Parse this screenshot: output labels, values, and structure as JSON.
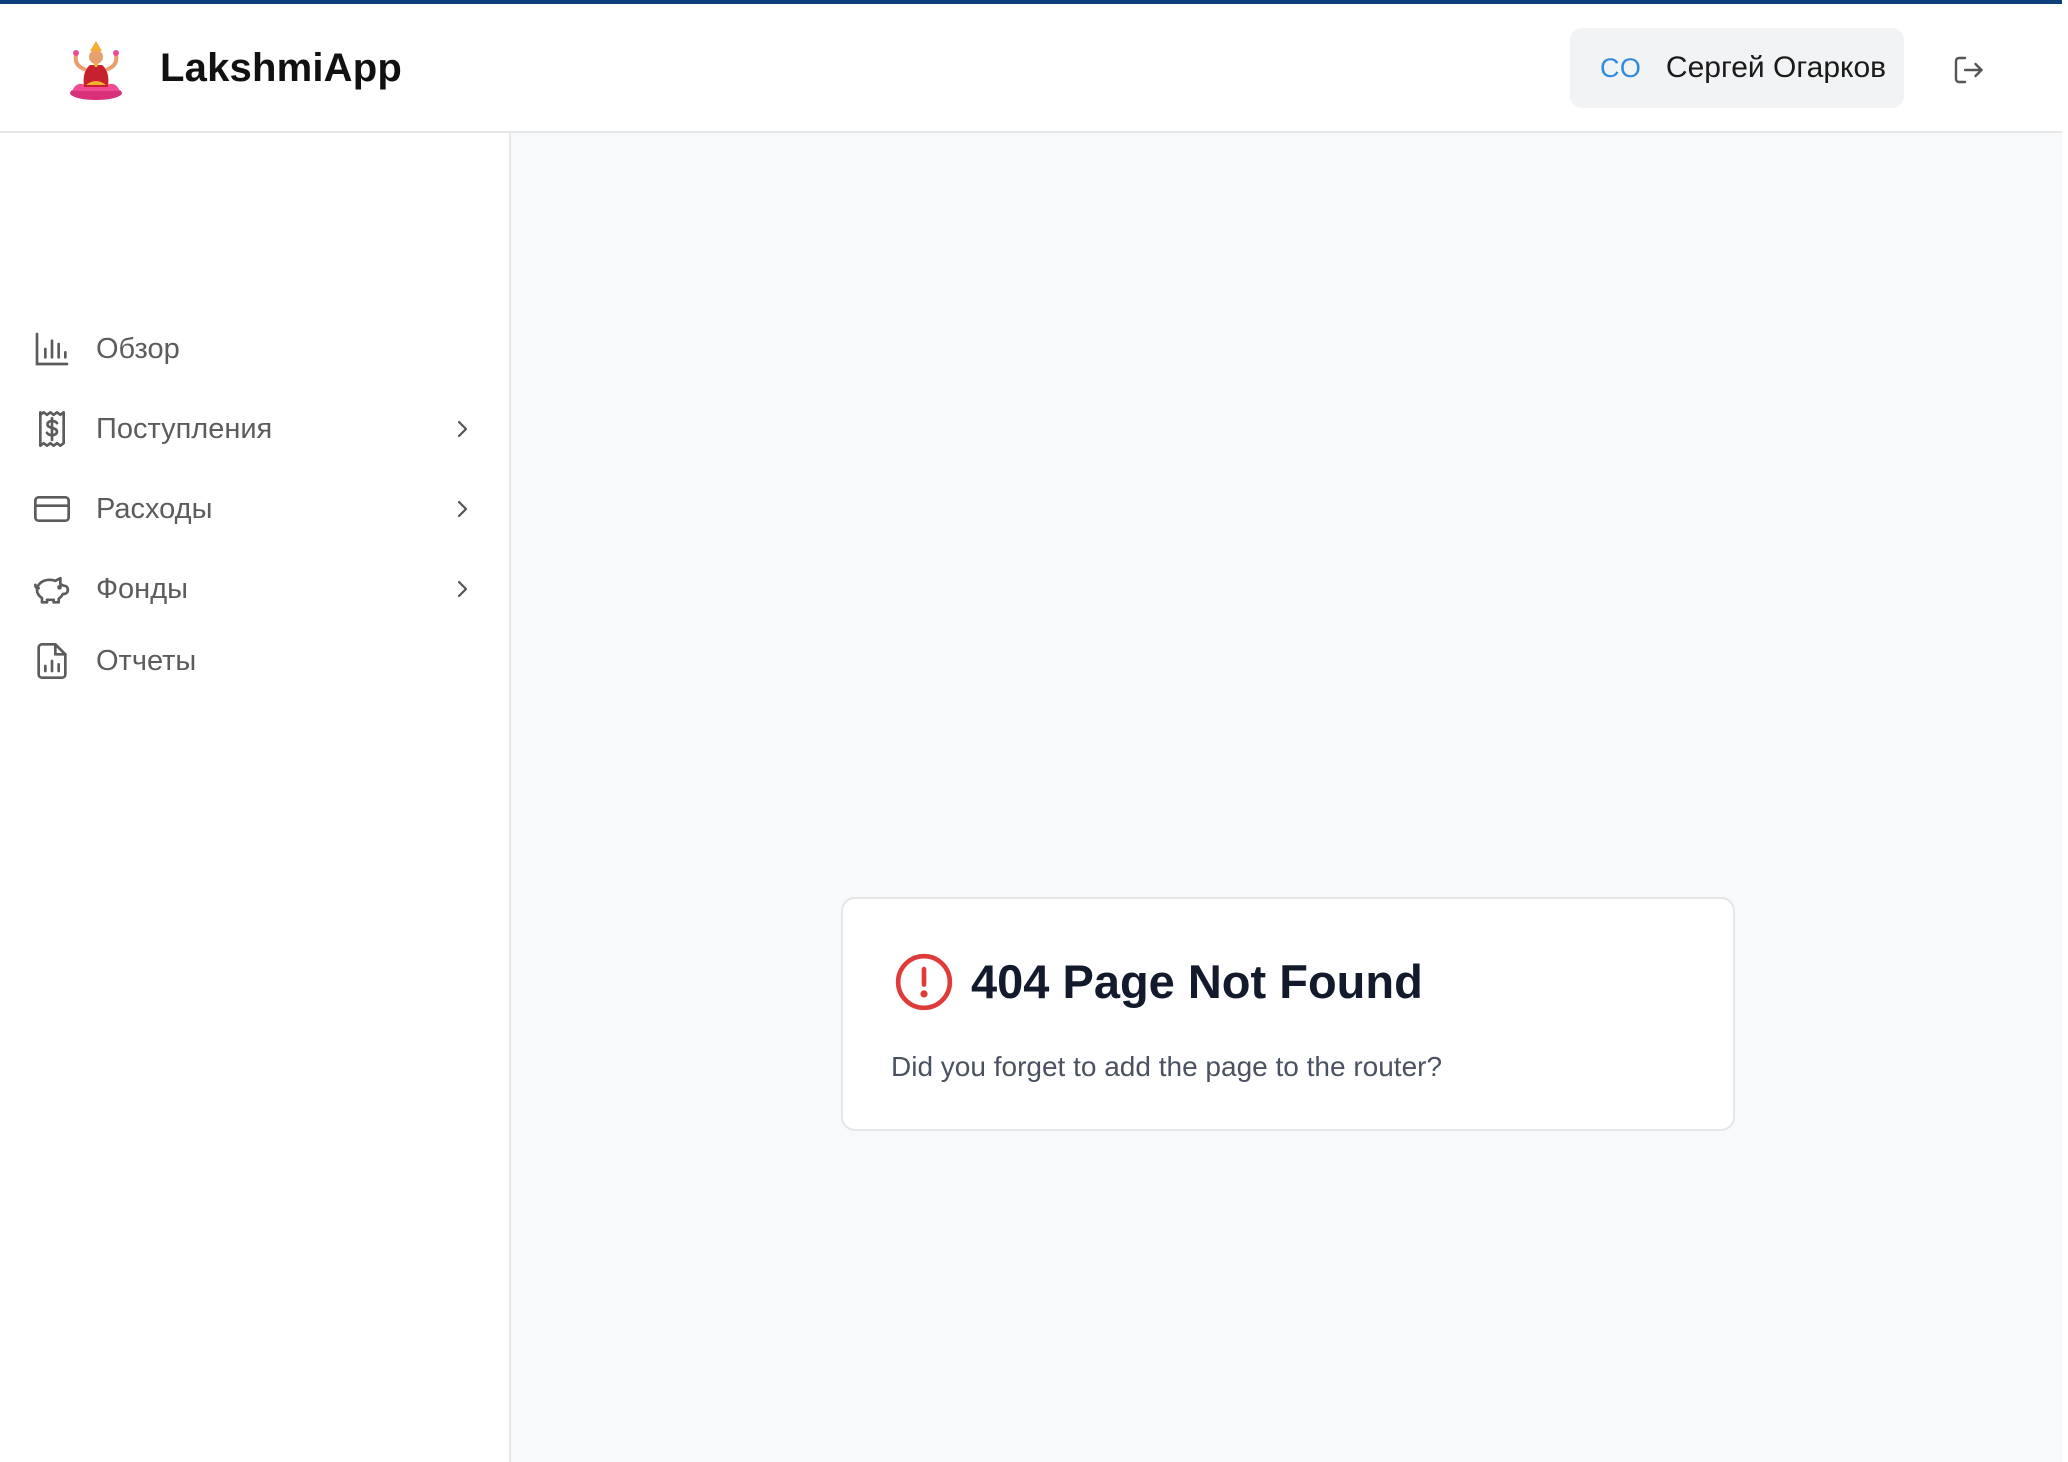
{
  "app": {
    "title": "LakshmiApp",
    "logo_icon": "lakshmi-logo-icon"
  },
  "user": {
    "initials": "СО",
    "name": "Сергей Огарков"
  },
  "logout": {
    "icon": "logout-icon"
  },
  "sidebar": {
    "items": [
      {
        "label": "Обзор",
        "icon": "bar-chart-icon",
        "has_submenu": false
      },
      {
        "label": "Поступления",
        "icon": "receipt-dollar-icon",
        "has_submenu": true
      },
      {
        "label": "Расходы",
        "icon": "credit-card-icon",
        "has_submenu": true
      },
      {
        "label": "Фонды",
        "icon": "piggy-bank-icon",
        "has_submenu": true
      },
      {
        "label": "Отчеты",
        "icon": "report-file-icon",
        "has_submenu": false
      }
    ]
  },
  "error": {
    "icon": "alert-circle-icon",
    "title": "404 Page Not Found",
    "description": "Did you forget to add the page to the router?"
  },
  "colors": {
    "accent_bar": "#0d3f7a",
    "initials": "#2e8be0",
    "error_icon": "#e03b3b",
    "main_bg": "#f8f9fa"
  }
}
